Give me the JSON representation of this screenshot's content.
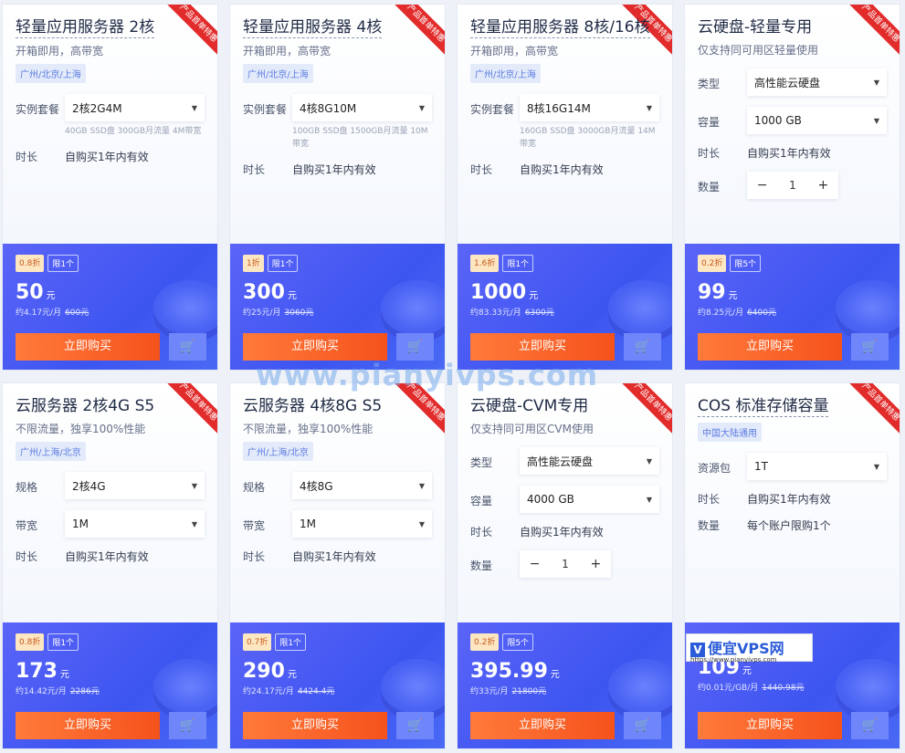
{
  "ribbon": "产品首单特惠",
  "buy_label": "立即购买",
  "cart_icon": "cart-icon",
  "cards": [
    {
      "title": "轻量应用服务器 2核",
      "underline": true,
      "sub": "开箱即用，高带宽",
      "tag": "广州/北京/上海",
      "rows": [
        {
          "label": "实例套餐",
          "type": "select",
          "value": "2核2G4M",
          "desc": "40GB SSD盘 300GB月流量 4M带宽"
        },
        {
          "label": "时长",
          "type": "text",
          "value": "自购买1年内有效"
        }
      ],
      "discount": "0.8折",
      "limit": "限1个",
      "price": "50",
      "unit": "元",
      "per": "约4.17元/月",
      "orig": "600元"
    },
    {
      "title": "轻量应用服务器 4核",
      "underline": true,
      "sub": "开箱即用，高带宽",
      "tag": "广州/北京/上海",
      "rows": [
        {
          "label": "实例套餐",
          "type": "select",
          "value": "4核8G10M",
          "desc": "100GB SSD盘 1500GB月流量 10M带宽"
        },
        {
          "label": "时长",
          "type": "text",
          "value": "自购买1年内有效"
        }
      ],
      "discount": "1折",
      "limit": "限1个",
      "price": "300",
      "unit": "元",
      "per": "约25元/月",
      "orig": "3060元"
    },
    {
      "title": "轻量应用服务器 8核/16核",
      "underline": true,
      "sub": "开箱即用，高带宽",
      "tag": "广州/北京/上海",
      "rows": [
        {
          "label": "实例套餐",
          "type": "select",
          "value": "8核16G14M",
          "desc": "160GB SSD盘 3000GB月流量 14M带宽"
        },
        {
          "label": "时长",
          "type": "text",
          "value": "自购买1年内有效"
        }
      ],
      "discount": "1.6折",
      "limit": "限1个",
      "price": "1000",
      "unit": "元",
      "per": "约83.33元/月",
      "orig": "6300元"
    },
    {
      "title": "云硬盘-轻量专用",
      "underline": false,
      "sub": "仅支持同可用区轻量使用",
      "tag": "",
      "rows": [
        {
          "label": "类型",
          "type": "select",
          "value": "高性能云硬盘"
        },
        {
          "label": "容量",
          "type": "select",
          "value": "1000 GB"
        },
        {
          "label": "时长",
          "type": "text",
          "value": "自购买1年内有效"
        },
        {
          "label": "数量",
          "type": "stepper",
          "value": "1"
        }
      ],
      "discount": "0.2折",
      "limit": "限5个",
      "price": "99",
      "unit": "元",
      "per": "约8.25元/月",
      "orig": "6400元"
    },
    {
      "title": "云服务器 2核4G S5",
      "underline": false,
      "sub": "不限流量，独享100%性能",
      "tag": "广州/上海/北京",
      "rows": [
        {
          "label": "规格",
          "type": "select",
          "value": "2核4G"
        },
        {
          "label": "带宽",
          "type": "select",
          "value": "1M"
        },
        {
          "label": "时长",
          "type": "text",
          "value": "自购买1年内有效"
        }
      ],
      "discount": "0.8折",
      "limit": "限1个",
      "price": "173",
      "unit": "元",
      "per": "约14.42元/月",
      "orig": "2286元"
    },
    {
      "title": "云服务器 4核8G S5",
      "underline": false,
      "sub": "不限流量，独享100%性能",
      "tag": "广州/上海/北京",
      "rows": [
        {
          "label": "规格",
          "type": "select",
          "value": "4核8G"
        },
        {
          "label": "带宽",
          "type": "select",
          "value": "1M"
        },
        {
          "label": "时长",
          "type": "text",
          "value": "自购买1年内有效"
        }
      ],
      "discount": "0.7折",
      "limit": "限1个",
      "price": "290",
      "unit": "元",
      "per": "约24.17元/月",
      "orig": "4424.4元"
    },
    {
      "title": "云硬盘-CVM专用",
      "underline": false,
      "sub": "仅支持同可用区CVM使用",
      "tag": "",
      "rows": [
        {
          "label": "类型",
          "type": "select",
          "value": "高性能云硬盘"
        },
        {
          "label": "容量",
          "type": "select",
          "value": "4000 GB"
        },
        {
          "label": "时长",
          "type": "text",
          "value": "自购买1年内有效"
        },
        {
          "label": "数量",
          "type": "stepper",
          "value": "1"
        }
      ],
      "discount": "0.2折",
      "limit": "限5个",
      "price": "395.99",
      "unit": "元",
      "per": "约33元/月",
      "orig": "21800元"
    },
    {
      "title": "COS 标准存储容量",
      "underline": true,
      "sub": "",
      "tag": "中国大陆通用",
      "rows": [
        {
          "label": "资源包",
          "type": "select",
          "value": "1T"
        },
        {
          "label": "时长",
          "type": "text",
          "value": "自购买1年内有效"
        },
        {
          "label": "数量",
          "type": "text",
          "value": "每个账户限购1个"
        }
      ],
      "discount": "",
      "limit": "",
      "price": "109",
      "unit": "元",
      "per": "约0.01元/GB/月",
      "orig": "1440.98元"
    }
  ],
  "watermark": "www.pianyivps.com",
  "logo": {
    "mark": "V",
    "name": "便宜VPS网",
    "url": "https://www.pianyivps.com"
  }
}
